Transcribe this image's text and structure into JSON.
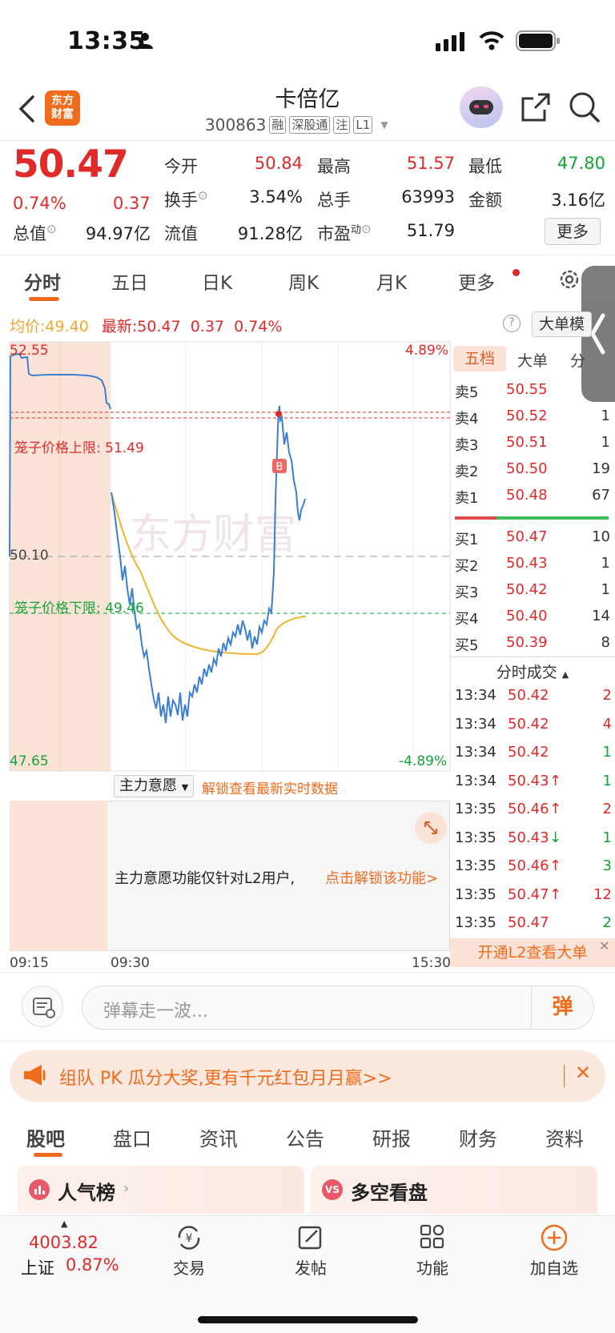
{
  "status": {
    "time": "13:35"
  },
  "header": {
    "logo_text": "东方\n财富",
    "stock_name": "卡倍亿",
    "stock_code": "300863",
    "tags": [
      "融",
      "深股通",
      "注",
      "L1"
    ]
  },
  "quote": {
    "price": "50.47",
    "change_pct": "0.74%",
    "change_abs": "0.37",
    "fields": [
      {
        "label": "今开",
        "value": "50.84",
        "color": "red"
      },
      {
        "label": "最高",
        "value": "51.57",
        "color": "red"
      },
      {
        "label": "最低",
        "value": "47.80",
        "color": "green"
      },
      {
        "label": "换手",
        "value": "3.54%",
        "color": "black"
      },
      {
        "label": "总手",
        "value": "63993",
        "color": "black"
      },
      {
        "label": "金额",
        "value": "3.16亿",
        "color": "black"
      },
      {
        "label": "总值",
        "value": "94.97亿",
        "color": "black"
      },
      {
        "label": "流值",
        "value": "91.28亿",
        "color": "black"
      },
      {
        "label": "市盈",
        "value": "51.79",
        "color": "black"
      }
    ],
    "pe_superscript": "动",
    "more_label": "更多"
  },
  "chart_tabs": [
    "分时",
    "五日",
    "日K",
    "周K",
    "月K",
    "更多"
  ],
  "chart_info": {
    "avg_label": "均价:",
    "avg_value": "49.40",
    "latest_label": "最新:",
    "latest_value": "50.47",
    "latest_change": "0.37",
    "latest_pct": "0.74%",
    "big_order_label": "大单模"
  },
  "chart": {
    "y_top": "52.55",
    "y_mid": "50.10",
    "y_bottom": "47.65",
    "pct_top": "4.89%",
    "pct_bottom": "-4.89%",
    "upper_limit_label": "笼子价格上限:",
    "upper_limit_value": "51.49",
    "lower_limit_label": "笼子价格下限:",
    "lower_limit_value": "49.46",
    "watermark": "东方财富",
    "marker": "B",
    "time_start": "09:15",
    "time_open": "09:30",
    "time_end": "15:30",
    "indicator_label": "主力意愿",
    "unlock_link": "解锁查看最新实时数据",
    "l2_notice": "主力意愿功能仅针对L2用户,",
    "l2_link": "点击解锁该功能>"
  },
  "order_book": {
    "tabs": [
      "五档",
      "大单",
      "分"
    ],
    "asks": [
      {
        "label": "卖5",
        "price": "50.55",
        "vol": ""
      },
      {
        "label": "卖4",
        "price": "50.52",
        "vol": "1"
      },
      {
        "label": "卖3",
        "price": "50.51",
        "vol": "1"
      },
      {
        "label": "卖2",
        "price": "50.50",
        "vol": "19"
      },
      {
        "label": "卖1",
        "price": "50.48",
        "vol": "67"
      }
    ],
    "bids": [
      {
        "label": "买1",
        "price": "50.47",
        "vol": "10"
      },
      {
        "label": "买2",
        "price": "50.43",
        "vol": "1"
      },
      {
        "label": "买3",
        "price": "50.42",
        "vol": "1"
      },
      {
        "label": "买4",
        "price": "50.40",
        "vol": "14"
      },
      {
        "label": "买5",
        "price": "50.39",
        "vol": "8"
      }
    ],
    "ticks_title": "分时成交",
    "ticks": [
      {
        "time": "13:34",
        "price": "50.42",
        "arrow": "",
        "vol": "2",
        "color": "red"
      },
      {
        "time": "13:34",
        "price": "50.42",
        "arrow": "",
        "vol": "4",
        "color": "red"
      },
      {
        "time": "13:34",
        "price": "50.42",
        "arrow": "",
        "vol": "1",
        "color": "green"
      },
      {
        "time": "13:34",
        "price": "50.43",
        "arrow": "↑",
        "vol": "1",
        "color": "green"
      },
      {
        "time": "13:35",
        "price": "50.46",
        "arrow": "↑",
        "vol": "2",
        "color": "red"
      },
      {
        "time": "13:35",
        "price": "50.43",
        "arrow": "↓",
        "vol": "1",
        "color": "green"
      },
      {
        "time": "13:35",
        "price": "50.46",
        "arrow": "↑",
        "vol": "3",
        "color": "green"
      },
      {
        "time": "13:35",
        "price": "50.47",
        "arrow": "↑",
        "vol": "12",
        "color": "red"
      },
      {
        "time": "13:35",
        "price": "50.47",
        "arrow": "",
        "vol": "2",
        "color": "green"
      }
    ],
    "l2_button": "开通L2查看大单"
  },
  "danmu": {
    "placeholder": "弹幕走一波...",
    "button": "弹"
  },
  "banner": {
    "text": "组队 PK 瓜分大奖,更有千元红包月月赢>>"
  },
  "news_tabs": [
    "股吧",
    "盘口",
    "资讯",
    "公告",
    "研报",
    "财务",
    "资料"
  ],
  "cards": [
    {
      "title": "人气榜"
    },
    {
      "title": "多空看盘"
    }
  ],
  "bottom_nav": {
    "index_value": "4003.82",
    "index_name": "上证",
    "index_pct": "0.87%",
    "items": [
      "交易",
      "发帖",
      "功能",
      "加自选"
    ]
  },
  "colors": {
    "up": "#e02a2a",
    "down": "#13a536",
    "accent": "#f06b1b",
    "price_line": "#3b7fd0",
    "avg_line": "#f0b430"
  }
}
